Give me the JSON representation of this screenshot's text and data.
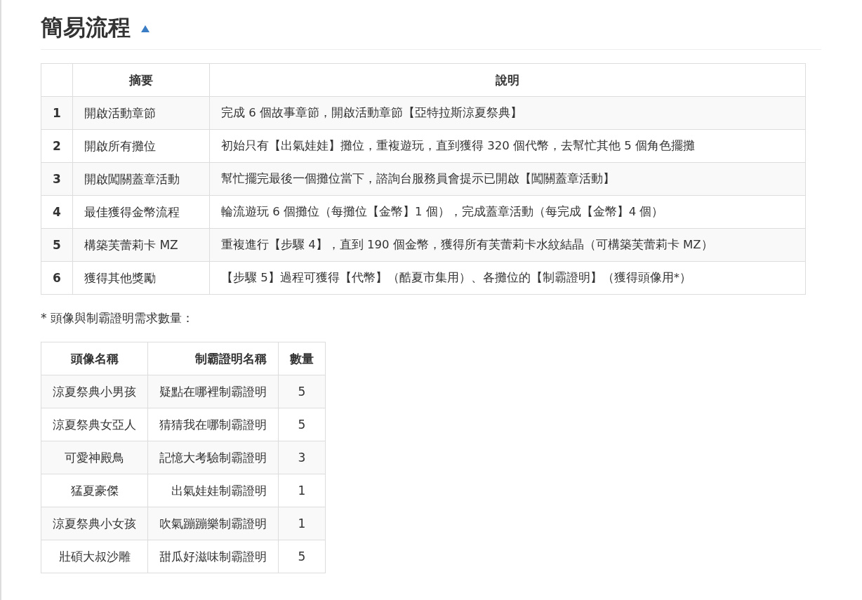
{
  "section": {
    "title": "簡易流程",
    "expanded": true
  },
  "steps_table": {
    "columns": [
      "",
      "摘要",
      "說明"
    ],
    "rows": [
      [
        "1",
        "開啟活動章節",
        "完成 6 個故事章節，開啟活動章節【亞特拉斯涼夏祭典】"
      ],
      [
        "2",
        "開啟所有攤位",
        "初始只有【出氣娃娃】攤位，重複遊玩，直到獲得 320 個代幣，去幫忙其他 5 個角色擺攤"
      ],
      [
        "3",
        "開啟闖關蓋章活動",
        "幫忙擺完最後一個攤位當下，諮詢台服務員會提示已開啟【闖關蓋章活動】"
      ],
      [
        "4",
        "最佳獲得金幣流程",
        "輪流遊玩 6 個攤位（每攤位【金幣】1 個），完成蓋章活動（每完成【金幣】4 個）"
      ],
      [
        "5",
        "構築芙蕾莉卡 MZ",
        "重複進行【步驟 4】，直到 190 個金幣，獲得所有芙蕾莉卡水紋結晶（可構築芙蕾莉卡 MZ）"
      ],
      [
        "6",
        "獲得其他獎勵",
        "【步驟 5】過程可獲得【代幣】（酷夏市集用）、各攤位的【制霸證明】（獲得頭像用*）"
      ]
    ]
  },
  "note": "* 頭像與制霸證明需求數量：",
  "avatar_table": {
    "columns": [
      "頭像名稱",
      "制霸證明名稱",
      "數量"
    ],
    "rows": [
      [
        "涼夏祭典小男孩",
        "疑點在哪裡制霸證明",
        "5"
      ],
      [
        "涼夏祭典女亞人",
        "猜猜我在哪制霸證明",
        "5"
      ],
      [
        "可愛神殿鳥",
        "記憶大考驗制霸證明",
        "3"
      ],
      [
        "猛夏豪傑",
        "出氣娃娃制霸證明",
        "1"
      ],
      [
        "涼夏祭典小女孩",
        "吹氣蹦蹦樂制霸證明",
        "1"
      ],
      [
        "壯碩大叔沙雕",
        "甜瓜好滋味制霸證明",
        "5"
      ]
    ]
  }
}
